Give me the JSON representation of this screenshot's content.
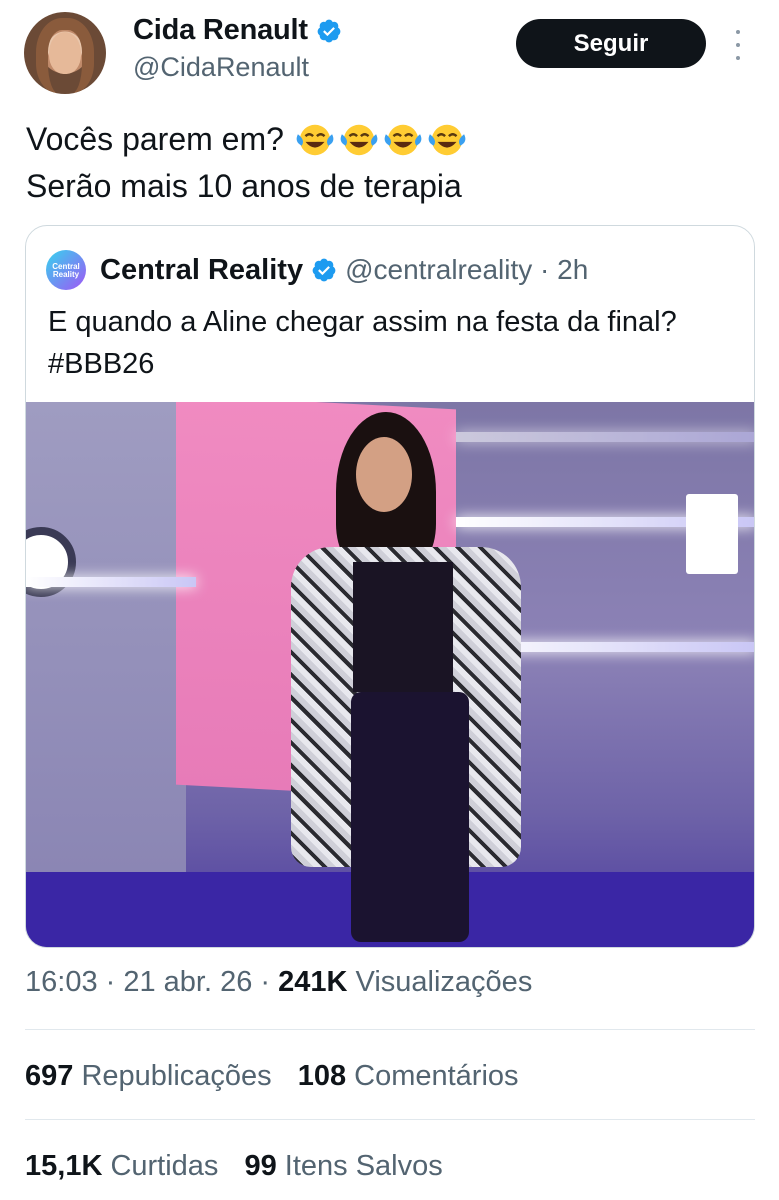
{
  "author": {
    "display_name": "Cida Renault",
    "handle": "@CidaRenault",
    "follow_label": "Seguir"
  },
  "tweet": {
    "line1": "Vocês parem em?",
    "line2": "Serão mais 10 anos de terapia",
    "emoji": [
      "face-with-tears-of-joy-icon",
      "face-with-tears-of-joy-icon",
      "face-with-tears-of-joy-icon",
      "face-with-tears-of-joy-icon"
    ]
  },
  "quote": {
    "avatar_logo": "Central Reality",
    "display_name": "Central Reality",
    "handle": "@centralreality",
    "separator": " · ",
    "time": "2h",
    "text": "E quando a Aline chegar assim na festa da final? #BBB26",
    "photo_icon": "photo-woman-red-carpet"
  },
  "meta": {
    "time": "16:03",
    "sep1": " · ",
    "date": "21 abr. 26",
    "sep2": " · ",
    "views_count": "241K",
    "views_label": " Visualizações"
  },
  "stats": {
    "reposts_count": "697",
    "reposts_label": " Republicações",
    "comments_count": "108",
    "comments_label": " Comentários",
    "likes_count": "15,1K",
    "likes_label": " Curtidas",
    "saves_count": "99",
    "saves_label": " Itens Salvos"
  },
  "colors": {
    "verified": "#1d9bf0",
    "text_primary": "#0f1419",
    "text_secondary": "#536471",
    "border": "#cfd9de"
  }
}
